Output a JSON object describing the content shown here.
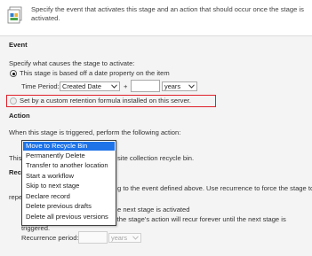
{
  "intro": {
    "text": "Specify the event that activates this stage and an action that should occur once the stage is activated."
  },
  "event": {
    "title": "Event",
    "prompt": "Specify what causes the stage to activate:",
    "option_date_property": "This stage is based off a date property on the item",
    "time_period_label": "Time Period:",
    "time_period_value": "Created Date",
    "plus_sign": "+",
    "offset_value": "",
    "offset_unit": "years",
    "option_custom_formula": "Set by a custom retention formula installed on this server."
  },
  "action": {
    "title": "Action",
    "prompt": "When this stage is triggered, perform the following action:",
    "description_start": "This",
    "description_tail": "site collection recycle bin.",
    "selected_action": "Move to Recycle Bin",
    "options": [
      "Move to Recycle Bin",
      "Permanently Delete",
      "Transfer to another location",
      "Start a workflow",
      "Skip to next stage",
      "Declare record",
      "Delete previous drafts",
      "Delete all previous versions"
    ]
  },
  "recurrence": {
    "title_fragment": "Rec",
    "description_tail": "g to the event defined above. Use recurrence to force the stage to",
    "description_cont_fragment": "repe",
    "checkbox_label_tail": "e next stage is activated",
    "checkbox_checked": true,
    "detail": "After the stage is first triggered, the stage's action will recur forever until the next stage is triggered.",
    "period_label": "Recurrence period:",
    "period_value": "",
    "period_unit": "years"
  },
  "colors": {
    "highlight": "#e0202a",
    "selected_item": "#1e73e8"
  }
}
